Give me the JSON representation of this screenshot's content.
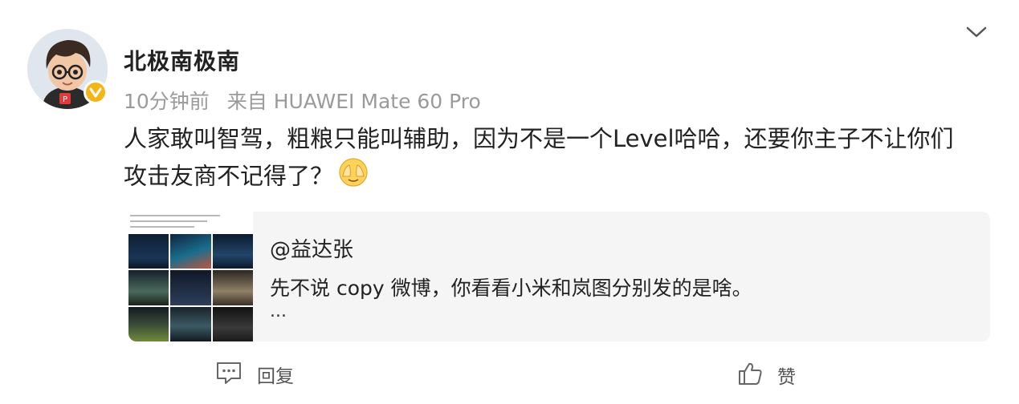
{
  "post": {
    "username": "北极南极南",
    "time": "10分钟前",
    "source": "来自 HUAWEI Mate 60 Pro",
    "content": "人家敢叫智驾，粗粮只能叫辅助，因为不是一个Level哈哈，还要你主子不让你们攻击友商不记得了？"
  },
  "quote": {
    "author": "@益达张",
    "text": "先不说 copy 微博，你看看小米和岚图分别发的是啥。",
    "more": "..."
  },
  "actions": {
    "reply": "回复",
    "like": "赞"
  },
  "colors": {
    "verified": "#f5b417",
    "meta": "#9a9a9a",
    "quote_bg": "#f5f5f5"
  },
  "icons": {
    "expand": "chevron-down-icon",
    "emoji": "facepalm-emoji-icon",
    "reply": "comment-icon",
    "like": "thumbs-up-icon"
  }
}
